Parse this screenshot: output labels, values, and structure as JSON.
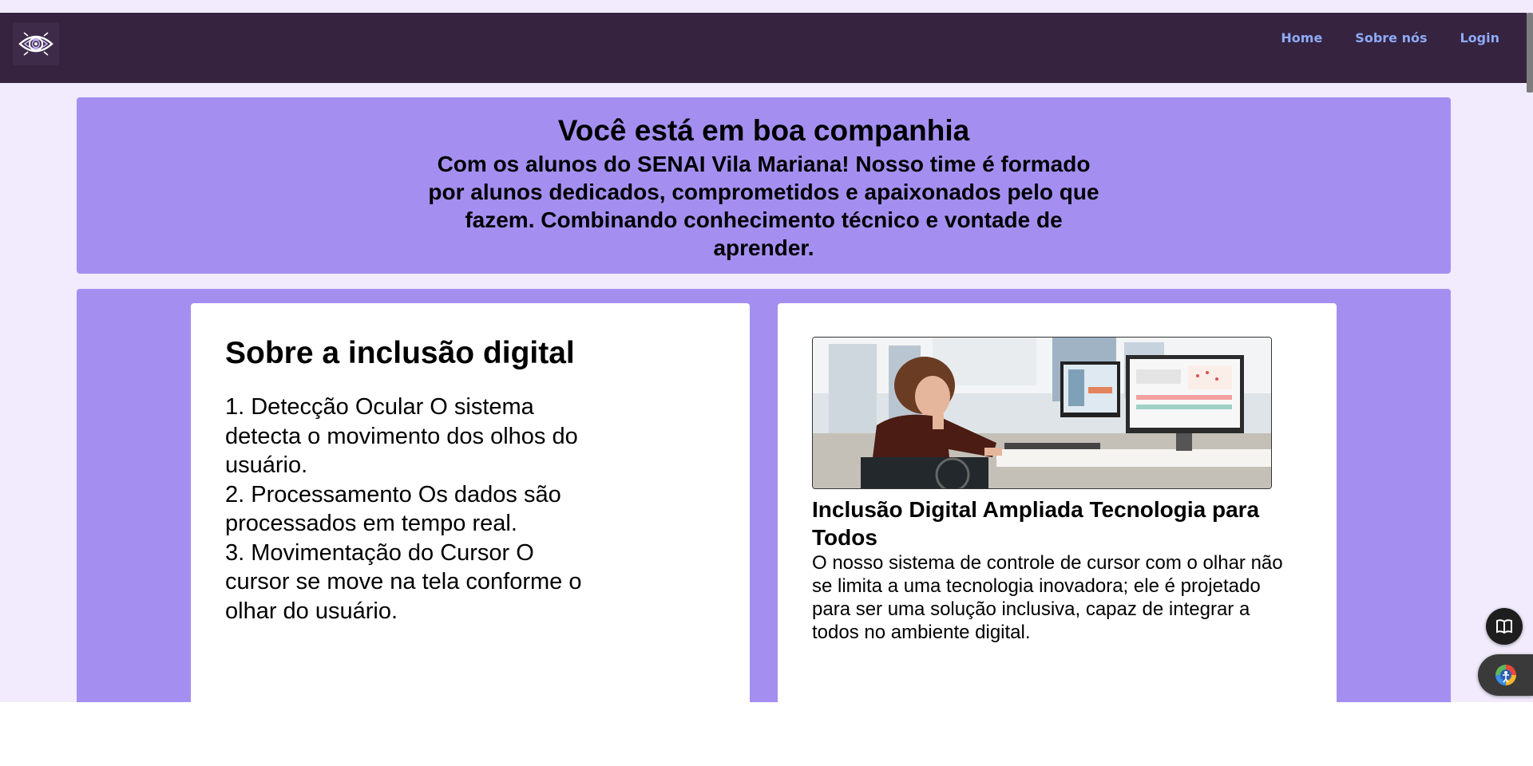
{
  "header": {
    "logo_icon": "eye-logo-icon",
    "nav": [
      {
        "label": "Home"
      },
      {
        "label": "Sobre nós"
      },
      {
        "label": "Login"
      }
    ]
  },
  "hero": {
    "title": "Você está em boa companhia",
    "text": "Com os alunos do SENAI Vila Mariana! Nosso time é formado por alunos dedicados, comprometidos e apaixonados pelo que fazem. Combinando conhecimento técnico e vontade de aprender."
  },
  "about_card": {
    "title": "Sobre a inclusão digital",
    "steps": [
      "1. Detecção Ocular O sistema detecta o movimento dos olhos do usuário.",
      "2. Processamento Os dados são processados em tempo real.",
      "3. Movimentação do Cursor O cursor se move na tela conforme o olhar do usuário."
    ]
  },
  "feature_card": {
    "image": "photo-woman-wheelchair-at-computer",
    "title": "Inclusão Digital Ampliada Tecnologia para Todos",
    "text": "O nosso sistema de controle de cursor com o olhar não se limita a uma tecnologia inovadora; ele é projetado para ser uma solução inclusiva, capaz de integrar a todos no ambiente digital."
  },
  "floating": {
    "reader_icon": "book-icon",
    "accessibility_icon": "accessibility-icon"
  },
  "colors": {
    "topbar": "#35233f",
    "nav_link": "#8eaaf7",
    "panel": "#a48ff1",
    "page_bg": "#f1ebfd"
  }
}
